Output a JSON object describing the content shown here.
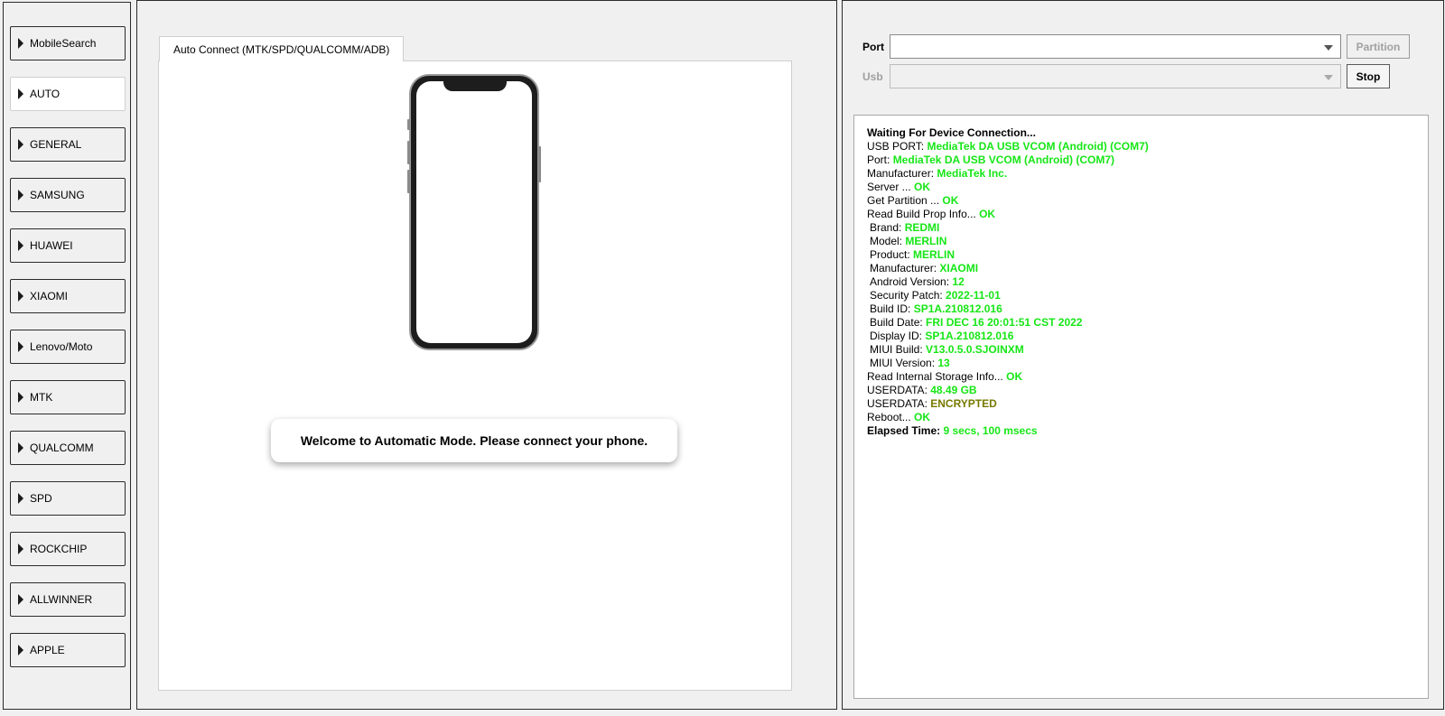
{
  "sidebar": {
    "items": [
      {
        "label": "MobileSearch",
        "active": false
      },
      {
        "label": "AUTO",
        "active": true
      },
      {
        "label": "GENERAL",
        "active": false
      },
      {
        "label": "SAMSUNG",
        "active": false
      },
      {
        "label": "HUAWEI",
        "active": false
      },
      {
        "label": "XIAOMI",
        "active": false
      },
      {
        "label": "Lenovo/Moto",
        "active": false
      },
      {
        "label": "MTK",
        "active": false
      },
      {
        "label": "QUALCOMM",
        "active": false
      },
      {
        "label": "SPD",
        "active": false
      },
      {
        "label": "ROCKCHIP",
        "active": false
      },
      {
        "label": "ALLWINNER",
        "active": false
      },
      {
        "label": "APPLE",
        "active": false
      }
    ]
  },
  "center": {
    "tab_label": "Auto Connect (MTK/SPD/QUALCOMM/ADB)",
    "welcome": "Welcome to Automatic Mode. Please connect your phone."
  },
  "right": {
    "port_label": "Port",
    "port_value": "",
    "usb_label": "Usb",
    "usb_value": "",
    "partition_button": "Partition",
    "stop_button": "Stop",
    "log": {
      "header": "Waiting For Device Connection...",
      "lines": [
        {
          "key": "USB PORT: ",
          "value": "MediaTek DA USB VCOM (Android) (COM7)"
        },
        {
          "key": "Port: ",
          "value": "MediaTek DA USB VCOM (Android) (COM7)"
        },
        {
          "key": "Manufacturer: ",
          "value": "MediaTek Inc."
        },
        {
          "key": "Server ... ",
          "value": "OK"
        },
        {
          "key": "Get Partition ... ",
          "value": "OK"
        },
        {
          "key": "Read Build Prop Info... ",
          "value": "OK"
        },
        {
          "key": " Brand: ",
          "value": "REDMI"
        },
        {
          "key": " Model: ",
          "value": "MERLIN"
        },
        {
          "key": " Product: ",
          "value": "MERLIN"
        },
        {
          "key": " Manufacturer: ",
          "value": "XIAOMI"
        },
        {
          "key": " Android Version: ",
          "value": "12"
        },
        {
          "key": " Security Patch: ",
          "value": "2022-11-01"
        },
        {
          "key": " Build ID: ",
          "value": "SP1A.210812.016"
        },
        {
          "key": " Build Date: ",
          "value": "FRI DEC 16 20:01:51 CST 2022"
        },
        {
          "key": " Display ID: ",
          "value": "SP1A.210812.016"
        },
        {
          "key": " MIUI Build: ",
          "value": "V13.0.5.0.SJOINXM"
        },
        {
          "key": " MIUI Version: ",
          "value": "13"
        },
        {
          "key": "Read Internal Storage Info... ",
          "value": "OK"
        },
        {
          "key": "USERDATA: ",
          "value": "48.49 GB"
        },
        {
          "key": "USERDATA: ",
          "value": "ENCRYPTED"
        },
        {
          "key": "Reboot... ",
          "value": "OK"
        },
        {
          "key": "Elapsed Time: ",
          "value": "9 secs, 100 msecs"
        }
      ]
    }
  },
  "colors": {
    "ok_green": "#16e616",
    "encrypted_olive": "#777a00",
    "panel_bg": "#f0f0f0",
    "border_dark": "#2b2b2b"
  },
  "icons": {
    "nav_arrow": "triangle-right-icon",
    "dropdown": "chevron-down-icon",
    "phone": "smartphone-illustration"
  }
}
